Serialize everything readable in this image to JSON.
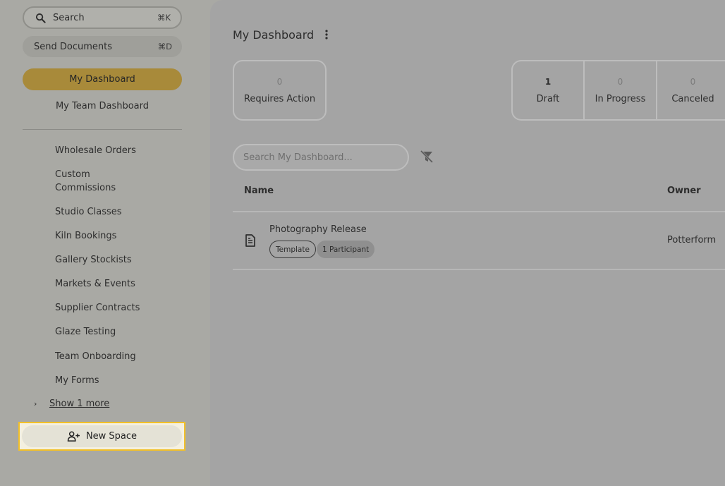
{
  "sidebar": {
    "search": {
      "label": "Search",
      "shortcut": "⌘K"
    },
    "send": {
      "label": "Send Documents",
      "shortcut": "⌘D"
    },
    "my_dashboard": "My Dashboard",
    "team_dashboard": "My Team Dashboard",
    "spaces": [
      {
        "label": "Wholesale Orders"
      },
      {
        "label": "Custom Commissions"
      },
      {
        "label": "Studio Classes"
      },
      {
        "label": "Kiln Bookings"
      },
      {
        "label": "Gallery Stockists"
      },
      {
        "label": "Markets & Events"
      },
      {
        "label": "Supplier Contracts"
      },
      {
        "label": "Glaze Testing"
      },
      {
        "label": "Team Onboarding"
      },
      {
        "label": "My Forms"
      }
    ],
    "show_more": "Show 1 more",
    "new_space": "New Space"
  },
  "main": {
    "title": "My Dashboard",
    "cards": {
      "requires_action": {
        "count": "0",
        "label": "Requires Action"
      },
      "draft": {
        "count": "1",
        "label": "Draft"
      },
      "in_progress": {
        "count": "0",
        "label": "In Progress"
      },
      "canceled": {
        "count": "0",
        "label": "Canceled"
      }
    },
    "search_placeholder": "Search My Dashboard...",
    "table": {
      "headers": {
        "name": "Name",
        "owner": "Owner"
      },
      "rows": [
        {
          "title": "Photography Release",
          "badges": [
            "Template",
            "1 Participant"
          ],
          "owner": "Potterform"
        }
      ]
    }
  },
  "colors": {
    "accent": "#a88a3a",
    "highlight": "#f2c028"
  }
}
